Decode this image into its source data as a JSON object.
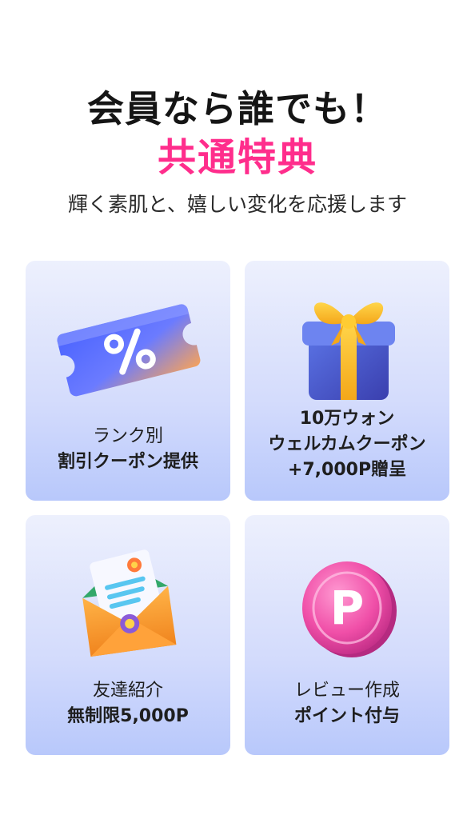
{
  "header": {
    "title_line1": "会員なら誰でも！",
    "title_line2": "共通特典",
    "subtitle": "輝く素肌と、嬉しい変化を応援します"
  },
  "colors": {
    "accent_pink": "#ff2d8c",
    "card_gradient_top": "#edf0fd",
    "card_gradient_bottom": "#b8c8fb"
  },
  "benefits": [
    {
      "icon": "coupon-ticket-icon",
      "line1": "ランク別",
      "line2": "割引クーポン提供"
    },
    {
      "icon": "gift-box-icon",
      "line1": "10万ウォン",
      "line2": "ウェルカムクーポン",
      "line3": "+7,000P贈呈"
    },
    {
      "icon": "envelope-letter-icon",
      "line1": "友達紹介",
      "line2": "無制限5,000P"
    },
    {
      "icon": "point-coin-icon",
      "icon_letter": "P",
      "line1": "レビュー作成",
      "line2": "ポイント付与"
    }
  ]
}
